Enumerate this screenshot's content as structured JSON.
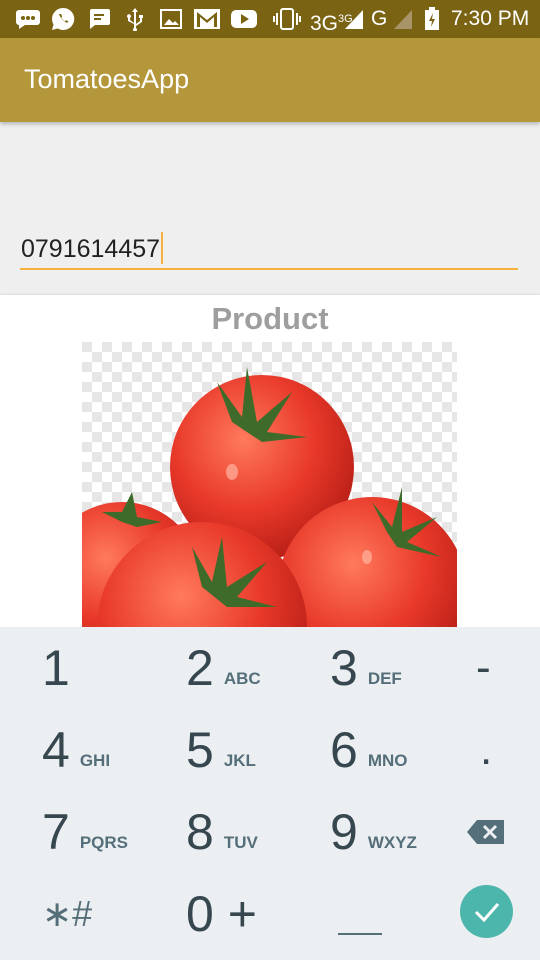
{
  "status_bar": {
    "network": "3G",
    "network_sup": "3G",
    "network2": "G",
    "time": "7:30 PM",
    "icons": [
      "chat-icon",
      "whatsapp-icon",
      "sms-icon",
      "usb-icon",
      "image-icon",
      "gmail-icon",
      "youtube-icon",
      "vibrate-icon",
      "signal-icon",
      "signal-icon",
      "battery-charging-icon"
    ]
  },
  "app_bar": {
    "title": "TomatoesApp"
  },
  "phone_input": {
    "value": "0791614457"
  },
  "product_card": {
    "title": "Product",
    "image": "tomatoes-image"
  },
  "keypad": {
    "rows": [
      [
        {
          "digit": "1",
          "letters": ""
        },
        {
          "digit": "2",
          "letters": "ABC"
        },
        {
          "digit": "3",
          "letters": "DEF"
        },
        {
          "digit": "-",
          "letters": ""
        }
      ],
      [
        {
          "digit": "4",
          "letters": "GHI"
        },
        {
          "digit": "5",
          "letters": "JKL"
        },
        {
          "digit": "6",
          "letters": "MNO"
        },
        {
          "digit": ".",
          "letters": ""
        }
      ],
      [
        {
          "digit": "7",
          "letters": "PQRS"
        },
        {
          "digit": "8",
          "letters": "TUV"
        },
        {
          "digit": "9",
          "letters": "WXYZ"
        },
        {
          "digit": "",
          "letters": ""
        }
      ],
      [
        {
          "digit": "∗#",
          "letters": ""
        },
        {
          "digit": "0 +",
          "letters": ""
        },
        {
          "digit": "_",
          "letters": ""
        },
        {
          "digit": "",
          "letters": ""
        }
      ]
    ],
    "backspace_icon": "backspace-icon",
    "done_icon": "check-icon",
    "accent_color": "#4db6ac"
  },
  "colors": {
    "status_bar": "#7a6312",
    "app_bar": "#b4963b",
    "input_underline": "#f4b23c",
    "keypad_bg": "#eceff1"
  }
}
